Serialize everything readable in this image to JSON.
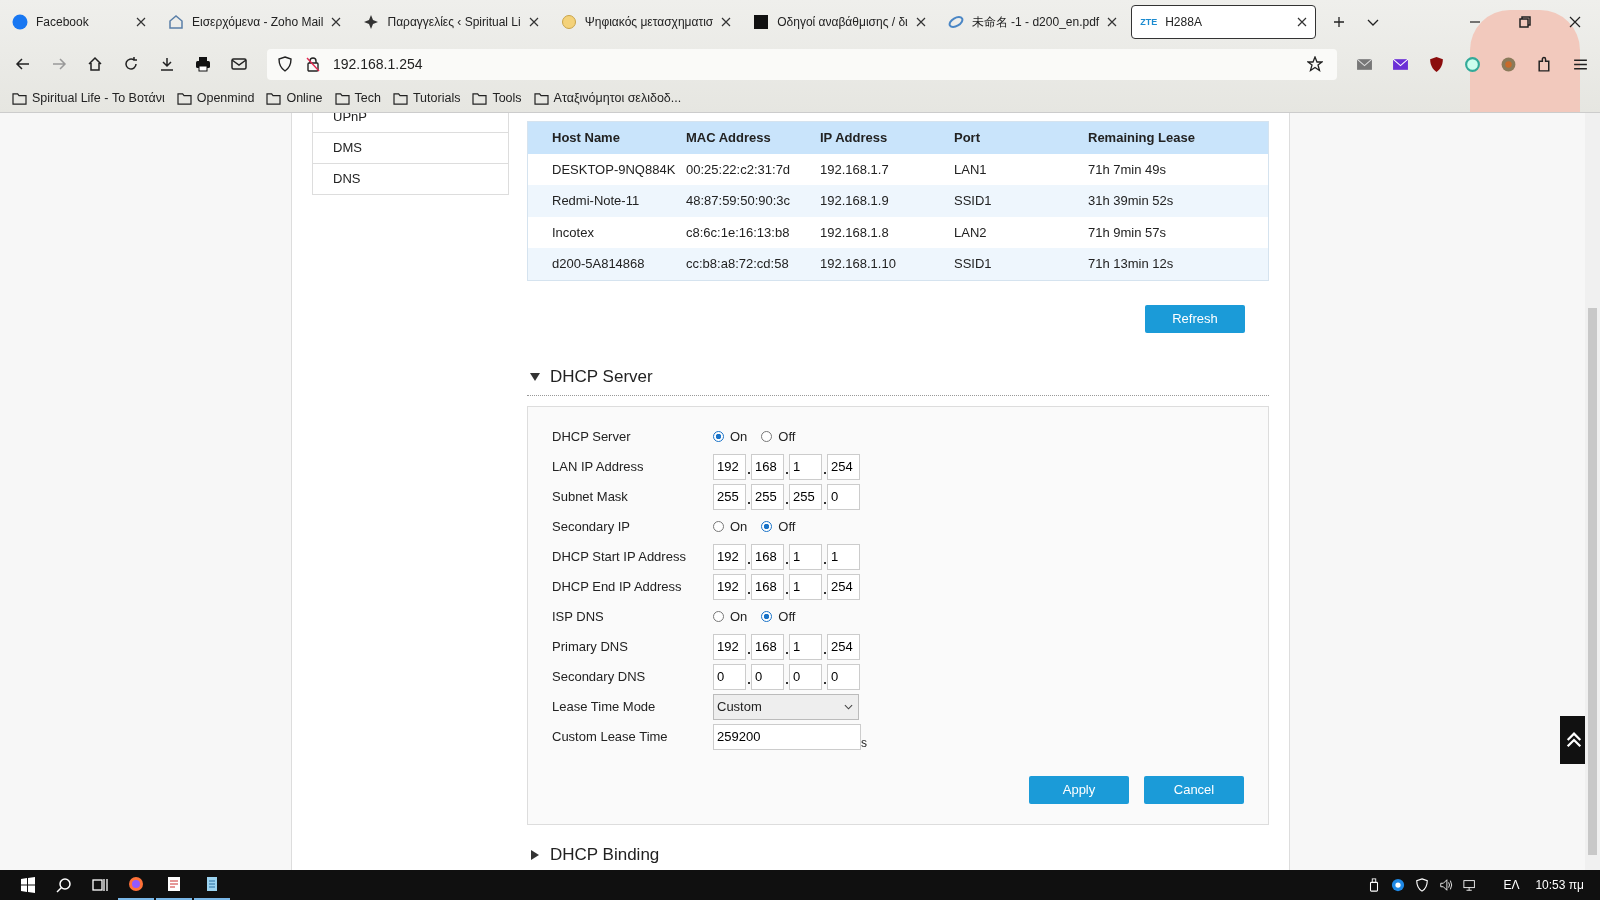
{
  "browser": {
    "tabs": [
      {
        "title": "Facebook",
        "selected": false
      },
      {
        "title": "Εισερχόμενα - Zoho Mail",
        "selected": false
      },
      {
        "title": "Παραγγελίες ‹ Spiritual Li",
        "selected": false
      },
      {
        "title": "Ψηφιακός μετασχηματισ",
        "selected": false
      },
      {
        "title": "Οδηγοί αναβάθμισης / δι",
        "selected": false
      },
      {
        "title": "未命名 -1 - d200_en.pdf",
        "selected": false
      },
      {
        "title": "H288A",
        "selected": true,
        "favicon_text": "ZTE"
      }
    ],
    "address": "192.168.1.254",
    "bookmarks": [
      "Spiritual Life - Το Βοτάνι",
      "Openmind",
      "Online",
      "Tech",
      "Tutorials",
      "Tools",
      "Αταξινόμητοι σελιδοδ..."
    ]
  },
  "page": {
    "sidebar": [
      "UPnP",
      "DMS",
      "DNS"
    ],
    "table": {
      "columns": [
        "Host Name",
        "MAC Address",
        "IP Address",
        "Port",
        "Remaining Lease"
      ],
      "rows": [
        [
          "DESKTOP-9NQ884K",
          "00:25:22:c2:31:7d",
          "192.168.1.7",
          "LAN1",
          "71h 7min 49s"
        ],
        [
          "Redmi-Note-11",
          "48:87:59:50:90:3c",
          "192.168.1.9",
          "SSID1",
          "31h 39min 52s"
        ],
        [
          "Incotex",
          "c8:6c:1e:16:13:b8",
          "192.168.1.8",
          "LAN2",
          "71h 9min 57s"
        ],
        [
          "d200-5A814868",
          "cc:b8:a8:72:cd:58",
          "192.168.1.10",
          "SSID1",
          "71h 13min 12s"
        ]
      ]
    },
    "refresh_button": "Refresh",
    "sections": [
      {
        "title": "DHCP Server",
        "expanded": true,
        "fields": [
          {
            "kind": "radio",
            "label": "DHCP Server",
            "options": [
              {
                "label": "On",
                "selected": true
              },
              {
                "label": "Off",
                "selected": false
              }
            ]
          },
          {
            "kind": "ip",
            "label": "LAN IP Address",
            "octets": [
              "192",
              "168",
              "1",
              "254"
            ]
          },
          {
            "kind": "ip",
            "label": "Subnet Mask",
            "octets": [
              "255",
              "255",
              "255",
              "0"
            ]
          },
          {
            "kind": "radio",
            "label": "Secondary IP",
            "options": [
              {
                "label": "On",
                "selected": false
              },
              {
                "label": "Off",
                "selected": true
              }
            ]
          },
          {
            "kind": "ip",
            "label": "DHCP Start IP Address",
            "octets": [
              "192",
              "168",
              "1",
              "1"
            ]
          },
          {
            "kind": "ip",
            "label": "DHCP End IP Address",
            "octets": [
              "192",
              "168",
              "1",
              "254"
            ]
          },
          {
            "kind": "radio",
            "label": "ISP DNS",
            "options": [
              {
                "label": "On",
                "selected": false
              },
              {
                "label": "Off",
                "selected": true
              }
            ]
          },
          {
            "kind": "ip",
            "label": "Primary DNS",
            "octets": [
              "192",
              "168",
              "1",
              "254"
            ]
          },
          {
            "kind": "ip",
            "label": "Secondary DNS",
            "octets": [
              "0",
              "0",
              "0",
              "0"
            ]
          },
          {
            "kind": "select",
            "label": "Lease Time Mode",
            "value": "Custom"
          },
          {
            "kind": "text",
            "label": "Custom Lease Time",
            "value": "259200",
            "unit": "s"
          }
        ],
        "buttons": [
          "Apply",
          "Cancel"
        ]
      },
      {
        "title": "DHCP Binding",
        "expanded": false
      }
    ]
  },
  "taskbar": {
    "language": "ΕΛ",
    "time": "10:53 πμ"
  }
}
